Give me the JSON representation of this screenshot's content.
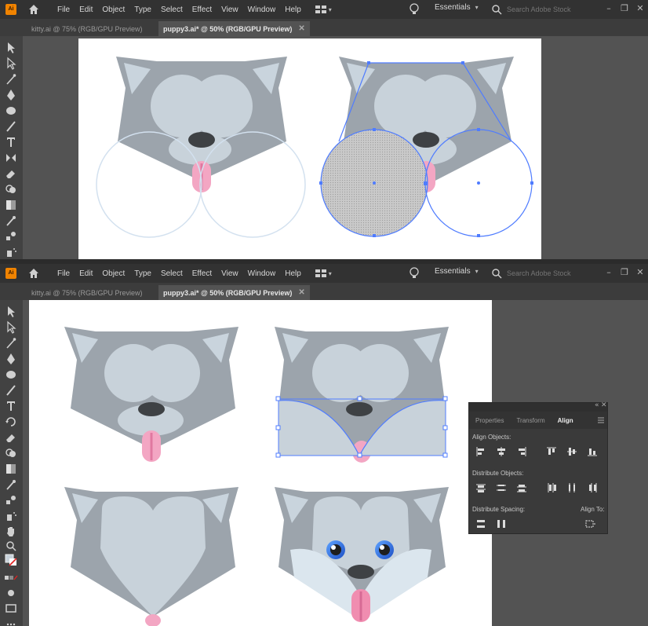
{
  "app": {
    "logo": "Ai",
    "menus": [
      "File",
      "Edit",
      "Object",
      "Type",
      "Select",
      "Effect",
      "View",
      "Window",
      "Help"
    ],
    "workspace": "Essentials",
    "search_placeholder": "Search Adobe Stock"
  },
  "tabs": [
    {
      "label": "kitty.ai @ 75% (RGB/GPU Preview)",
      "active": false
    },
    {
      "label": "puppy3.ai* @ 50% (RGB/GPU Preview)",
      "active": true
    }
  ],
  "icons": {
    "home": "home-icon",
    "bulb": "lightbulb-icon",
    "search": "search-icon",
    "layout": "arrange-documents-icon"
  },
  "colors": {
    "ui_bg": "#535353",
    "menubar": "#323232",
    "selection": "#4f7cff",
    "fur_dark": "#99a3ab",
    "fur_light": "#c5d3de",
    "tongue": "#ef9ab8",
    "eye_blue": "#2f6fd9"
  },
  "align_panel": {
    "tabs": [
      "Properties",
      "Transform",
      "Align"
    ],
    "active_tab": "Align",
    "sections": {
      "align_objects": "Align Objects:",
      "distribute_objects": "Distribute Objects:",
      "distribute_spacing": "Distribute Spacing:",
      "align_to": "Align To:"
    }
  }
}
